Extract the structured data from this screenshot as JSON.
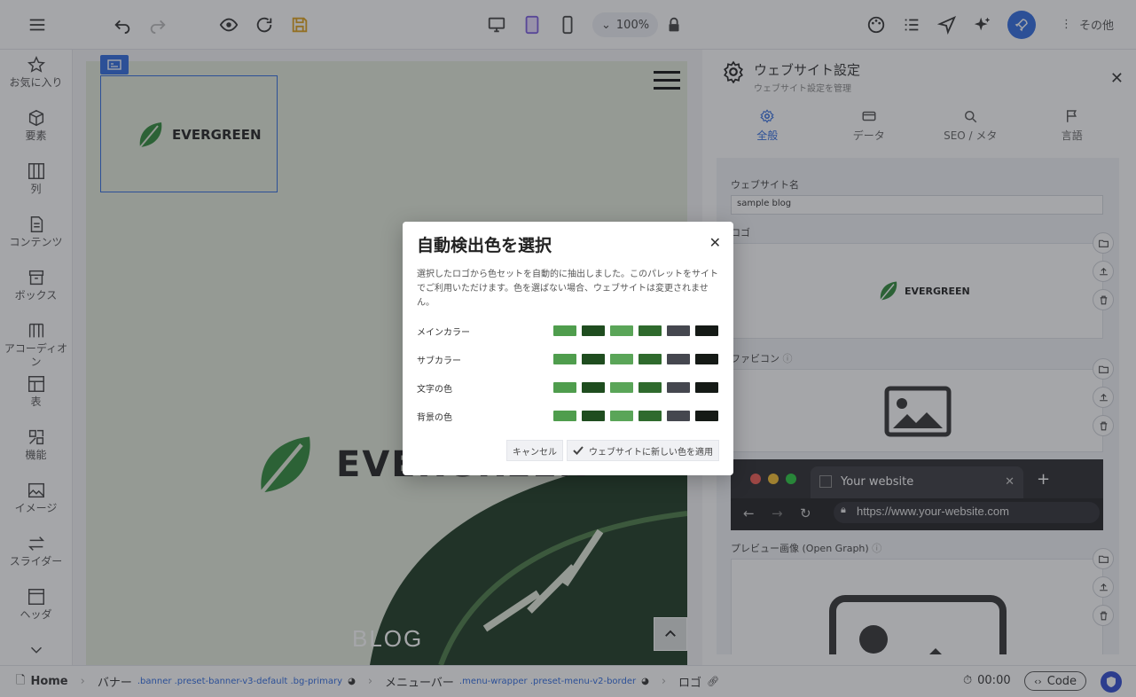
{
  "toolbar": {
    "zoom": "100%",
    "more_label": "その他"
  },
  "sidebar": {
    "items": [
      {
        "label": "お気に入り",
        "icon": "star-icon"
      },
      {
        "label": "要素",
        "icon": "cube-icon"
      },
      {
        "label": "列",
        "icon": "columns-icon"
      },
      {
        "label": "コンテンツ",
        "icon": "document-icon"
      },
      {
        "label": "ボックス",
        "icon": "box-icon"
      },
      {
        "label": "アコーディオン",
        "icon": "accordion-icon"
      },
      {
        "label": "表",
        "icon": "table-icon"
      },
      {
        "label": "機能",
        "icon": "features-icon"
      },
      {
        "label": "イメージ",
        "icon": "image-icon"
      },
      {
        "label": "スライダー",
        "icon": "slider-icon"
      },
      {
        "label": "ヘッダ",
        "icon": "header-icon"
      }
    ]
  },
  "canvas": {
    "logo_text": "EVERGREEN",
    "blog_label": "BLOG"
  },
  "panel": {
    "title": "ウェブサイト設定",
    "subtitle": "ウェブサイト設定を管理",
    "tabs": [
      {
        "label": "全般",
        "icon": "gear-icon"
      },
      {
        "label": "データ",
        "icon": "card-icon"
      },
      {
        "label": "SEO / メタ",
        "icon": "search-icon"
      },
      {
        "label": "言語",
        "icon": "flag-icon"
      }
    ],
    "site_name_label": "ウェブサイト名",
    "site_name_value": "sample blog",
    "logo_label": "ロゴ",
    "favicon_label": "ファビコン",
    "og_label": "プレビュー画像 (Open Graph)",
    "browser_tab_title": "Your website",
    "browser_url": "https://www.your-website.com"
  },
  "modal": {
    "title": "自動検出色を選択",
    "description": "選択したロゴから色セットを自動的に抽出しました。このパレットをサイトでご利用いただけます。色を選ばない場合、ウェブサイトは変更されません。",
    "rows": [
      {
        "label": "メインカラー"
      },
      {
        "label": "サブカラー"
      },
      {
        "label": "文字の色"
      },
      {
        "label": "背景の色"
      }
    ],
    "palette": [
      "#4f9d4d",
      "#1f4d1f",
      "#5aa558",
      "#2f6a2d",
      "#45474f",
      "#151a16"
    ],
    "cancel_label": "キャンセル",
    "apply_label": "ウェブサイトに新しい色を適用"
  },
  "bottombar": {
    "home": "Home",
    "crumb1": "バナー",
    "crumb1_class": ".banner .preset-banner-v3-default .bg-primary",
    "crumb2": "メニューバー",
    "crumb2_class": ".menu-wrapper .preset-menu-v2-border",
    "crumb3": "ロゴ",
    "time": "00:00",
    "code_label": "Code"
  }
}
